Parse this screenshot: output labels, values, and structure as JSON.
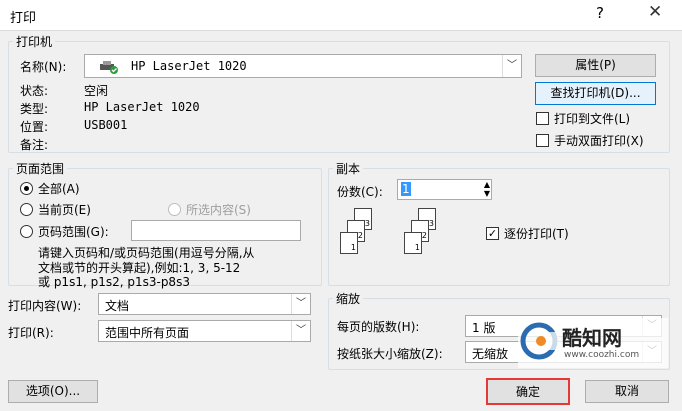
{
  "window": {
    "title": "打印",
    "help_label": "?",
    "close_label": "✕"
  },
  "printer": {
    "legend": "打印机",
    "name_label": "名称(N):",
    "name_value": "HP LaserJet 1020",
    "properties_button": "属性(P)",
    "find_button": "查找打印机(D)...",
    "status_label": "状态:",
    "status_value": "空闲",
    "type_label": "类型:",
    "type_value": "HP LaserJet 1020",
    "where_label": "位置:",
    "where_value": "USB001",
    "comment_label": "备注:",
    "print_to_file": "打印到文件(L)",
    "manual_duplex": "手动双面打印(X)"
  },
  "page_range": {
    "legend": "页面范围",
    "all": "全部(A)",
    "current": "当前页(E)",
    "selection": "所选内容(S)",
    "pages": "页码范围(G):",
    "pages_value": "",
    "hint_line1": "请键入页码和/或页码范围(用逗号分隔,从",
    "hint_line2": "文档或节的开头算起),例如:1, 3, 5-12",
    "hint_line3": "或 p1s1, p1s2, p1s3-p8s3"
  },
  "copies": {
    "legend": "副本",
    "count_label": "份数(C):",
    "count_value": "1",
    "collate_label": "逐份打印(T)",
    "collate_checked": true,
    "page_numbers": [
      "1",
      "2",
      "3"
    ]
  },
  "print_what": {
    "label": "打印内容(W):",
    "value": "文档"
  },
  "print": {
    "label": "打印(R):",
    "value": "范围中所有页面"
  },
  "zoom": {
    "legend": "缩放",
    "pages_per_sheet_label": "每页的版数(H):",
    "pages_per_sheet_value": "1 版",
    "scale_label": "按纸张大小缩放(Z):",
    "scale_value": "无缩放"
  },
  "footer": {
    "options_button": "选项(O)...",
    "ok_button": "确定",
    "cancel_button": "取消"
  },
  "watermark": {
    "brand": "酷知网",
    "url": "www.coozhi.com"
  },
  "colors": {
    "focus_highlight": "#e53935",
    "accent_blue": "#2b6cb0"
  }
}
